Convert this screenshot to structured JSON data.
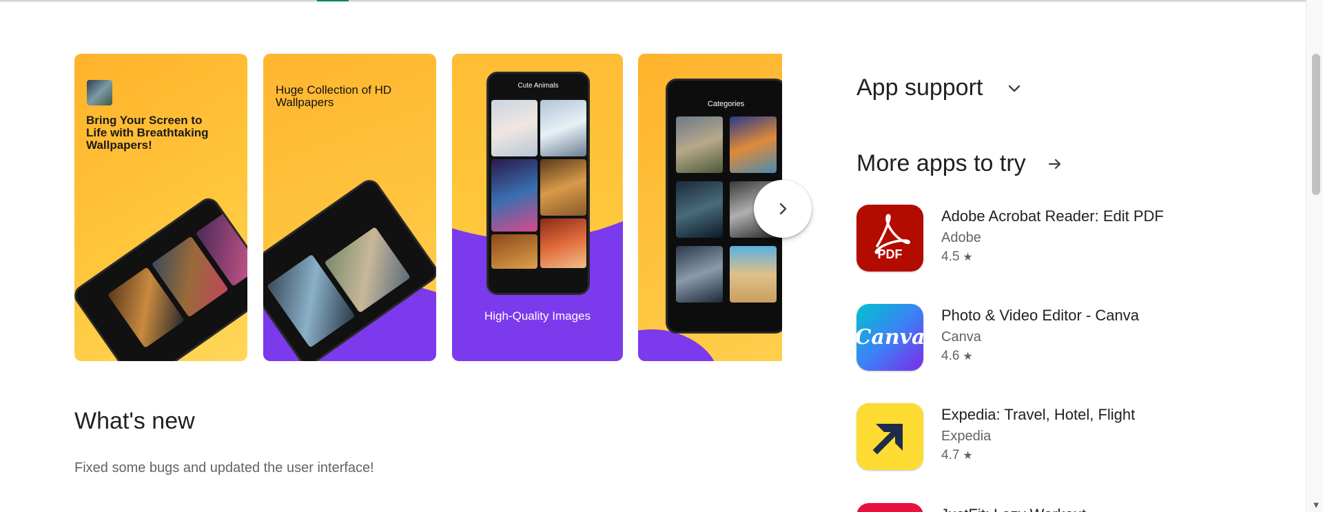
{
  "screenshots": {
    "shot1_caption": "Bring Your Screen to Life with Breathtaking Wallpapers!",
    "shot2_caption": "Huge Collection of HD Wallpapers",
    "shot3_phone_title": "Cute Animals",
    "shot3_caption": "High-Quality Images",
    "shot4_phone_title": "Categories"
  },
  "whats_new": {
    "title": "What's new",
    "text": "Fixed some bugs and updated the user interface!"
  },
  "app_support": {
    "title": "App support"
  },
  "more_apps": {
    "title": "More apps to try",
    "apps": [
      {
        "name": "Adobe Acrobat Reader: Edit PDF",
        "developer": "Adobe",
        "rating": "4.5",
        "icon": "adobe-acrobat-icon",
        "icon_text": "PDF"
      },
      {
        "name": "Photo & Video Editor - Canva",
        "developer": "Canva",
        "rating": "4.6",
        "icon": "canva-icon",
        "icon_text": "Canva"
      },
      {
        "name": "Expedia: Travel, Hotel, Flight",
        "developer": "Expedia",
        "rating": "4.7",
        "icon": "expedia-icon"
      }
    ],
    "partial_app_name": "JustFit: Lazy Workout"
  },
  "colors": {
    "accent_green": "#01875f",
    "adobe_red": "#b30b00",
    "expedia_yellow": "#fddb32",
    "purple": "#7c3aed",
    "orange": "#ffb22c"
  }
}
